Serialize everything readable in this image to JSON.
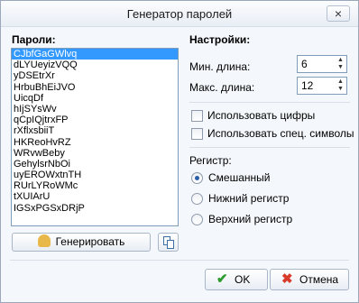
{
  "window": {
    "title": "Генератор паролей",
    "close_label": "×"
  },
  "passwords": {
    "label": "Пароли:",
    "items": [
      "CJbfGaGWlvq",
      "dLYUeyizVQQ",
      "yDSEtrXr",
      "HrbuBhEiJVO",
      "UicqDf",
      "hIjSYsWv",
      "qCpIQjtrxFP",
      "rXflxsbiiT",
      "HKReoHvRZ",
      "WRvwBeby",
      "GehylsrNbOi",
      "uyEROWxtnTH",
      "RUrLYRoWMc",
      "tXUIArU",
      "IGSxPGSxDRjP"
    ],
    "selected_index": 0
  },
  "actions": {
    "generate_label": "Генерировать"
  },
  "settings": {
    "label": "Настройки:",
    "min_length_label": "Мин. длина:",
    "min_length_value": "6",
    "max_length_label": "Макс. длина:",
    "max_length_value": "12",
    "use_digits_label": "Использовать цифры",
    "use_special_label": "Использовать спец. символы",
    "case_label": "Регистр:",
    "case_options": [
      "Смешанный",
      "Нижний регистр",
      "Верхний регистр"
    ],
    "case_selected": 0
  },
  "footer": {
    "ok_label": "OK",
    "cancel_label": "Отмена"
  },
  "icons": {
    "ok": "check-icon",
    "cancel": "cross-icon",
    "generate": "wizard-icon",
    "copy": "copy-icon"
  }
}
